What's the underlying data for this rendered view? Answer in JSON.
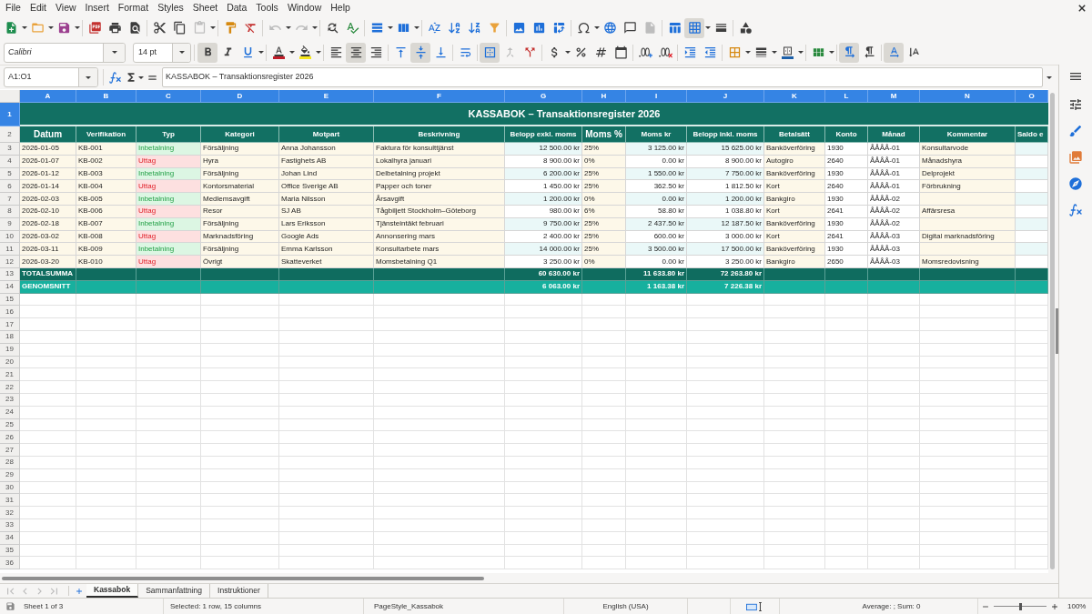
{
  "menu": [
    "File",
    "Edit",
    "View",
    "Insert",
    "Format",
    "Styles",
    "Sheet",
    "Data",
    "Tools",
    "Window",
    "Help"
  ],
  "standard_toolbar": {
    "groups": [
      [
        {
          "kind": "new",
          "dropdown": true,
          "pressed": false,
          "disabled": false
        },
        {
          "kind": "open",
          "dropdown": true,
          "pressed": false,
          "disabled": false
        },
        {
          "kind": "save",
          "dropdown": true,
          "pressed": false,
          "disabled": false
        }
      ],
      [
        {
          "kind": "pdf",
          "dropdown": false,
          "pressed": false,
          "disabled": false
        },
        {
          "kind": "print",
          "dropdown": false,
          "pressed": false,
          "disabled": false
        },
        {
          "kind": "preview",
          "dropdown": false,
          "pressed": false,
          "disabled": false
        }
      ],
      [
        {
          "kind": "cut",
          "dropdown": false,
          "pressed": false,
          "disabled": false
        },
        {
          "kind": "copy",
          "dropdown": false,
          "pressed": false,
          "disabled": false
        },
        {
          "kind": "paste",
          "dropdown": true,
          "pressed": false,
          "disabled": true
        }
      ],
      [
        {
          "kind": "clone",
          "dropdown": false,
          "pressed": false,
          "disabled": false
        },
        {
          "kind": "clear",
          "dropdown": false,
          "pressed": false,
          "disabled": false
        }
      ],
      [
        {
          "kind": "undo",
          "dropdown": true,
          "pressed": false,
          "disabled": true
        },
        {
          "kind": "redo",
          "dropdown": true,
          "pressed": false,
          "disabled": true
        }
      ],
      [
        {
          "kind": "find",
          "dropdown": false,
          "pressed": false,
          "disabled": false
        },
        {
          "kind": "spelling",
          "dropdown": false,
          "pressed": false,
          "disabled": false
        }
      ],
      [
        {
          "kind": "rows",
          "dropdown": true,
          "pressed": false,
          "disabled": false
        },
        {
          "kind": "columns",
          "dropdown": true,
          "pressed": false,
          "disabled": false
        }
      ],
      [
        {
          "kind": "sort",
          "dropdown": false,
          "pressed": false,
          "disabled": false
        },
        {
          "kind": "sortasc",
          "dropdown": false,
          "pressed": false,
          "disabled": false
        },
        {
          "kind": "sortdesc",
          "dropdown": false,
          "pressed": false,
          "disabled": false
        },
        {
          "kind": "filter",
          "dropdown": false,
          "pressed": false,
          "disabled": false
        }
      ],
      [
        {
          "kind": "image",
          "dropdown": false,
          "pressed": false,
          "disabled": false
        },
        {
          "kind": "chart",
          "dropdown": false,
          "pressed": false,
          "disabled": false
        },
        {
          "kind": "pivot",
          "dropdown": false,
          "pressed": false,
          "disabled": false
        }
      ],
      [
        {
          "kind": "symbol",
          "dropdown": true,
          "pressed": false,
          "disabled": false
        },
        {
          "kind": "hyperlink",
          "dropdown": false,
          "pressed": false,
          "disabled": false
        },
        {
          "kind": "comment",
          "dropdown": false,
          "pressed": false,
          "disabled": false
        },
        {
          "kind": "headers",
          "dropdown": false,
          "pressed": false,
          "disabled": true
        }
      ],
      [
        {
          "kind": "printarea",
          "dropdown": false,
          "pressed": false,
          "disabled": false
        },
        {
          "kind": "freeze",
          "dropdown": true,
          "pressed": true,
          "disabled": false
        },
        {
          "kind": "split",
          "dropdown": false,
          "pressed": false,
          "disabled": false
        }
      ],
      [
        {
          "kind": "shapes",
          "dropdown": false,
          "pressed": false,
          "disabled": false
        }
      ]
    ]
  },
  "formatting_toolbar": {
    "font_name": "Calibri",
    "font_size": "14 pt",
    "groups": [
      [
        {
          "kind": "bold",
          "dropdown": false,
          "pressed": true,
          "disabled": false
        },
        {
          "kind": "italic",
          "dropdown": false,
          "pressed": false,
          "disabled": false
        },
        {
          "kind": "underline",
          "dropdown": true,
          "pressed": false,
          "disabled": false
        }
      ],
      [
        {
          "kind": "fontcolor",
          "dropdown": true,
          "pressed": false,
          "disabled": false
        },
        {
          "kind": "highlight",
          "dropdown": true,
          "pressed": false,
          "disabled": false
        }
      ],
      [
        {
          "kind": "left",
          "dropdown": false,
          "pressed": false,
          "disabled": false
        },
        {
          "kind": "center",
          "dropdown": false,
          "pressed": true,
          "disabled": false
        },
        {
          "kind": "right",
          "dropdown": false,
          "pressed": false,
          "disabled": false
        }
      ],
      [
        {
          "kind": "top",
          "dropdown": false,
          "pressed": false,
          "disabled": false
        },
        {
          "kind": "middle",
          "dropdown": false,
          "pressed": true,
          "disabled": false
        },
        {
          "kind": "bottom",
          "dropdown": false,
          "pressed": false,
          "disabled": false
        }
      ],
      [
        {
          "kind": "wrap",
          "dropdown": false,
          "pressed": false,
          "disabled": false
        }
      ],
      [
        {
          "kind": "mergecenter",
          "dropdown": false,
          "pressed": true,
          "disabled": false
        },
        {
          "kind": "merge",
          "dropdown": false,
          "pressed": false,
          "disabled": true
        },
        {
          "kind": "unmerge",
          "dropdown": false,
          "pressed": false,
          "disabled": false
        }
      ],
      [
        {
          "kind": "currency",
          "dropdown": true,
          "pressed": false,
          "disabled": false
        },
        {
          "kind": "percent",
          "dropdown": false,
          "pressed": false,
          "disabled": false
        },
        {
          "kind": "number",
          "dropdown": false,
          "pressed": false,
          "disabled": false
        },
        {
          "kind": "date",
          "dropdown": false,
          "pressed": false,
          "disabled": false
        }
      ],
      [
        {
          "kind": "adddecimal",
          "dropdown": false,
          "pressed": false,
          "disabled": false
        },
        {
          "kind": "deldecimal",
          "dropdown": false,
          "pressed": false,
          "disabled": false
        }
      ],
      [
        {
          "kind": "indent",
          "dropdown": false,
          "pressed": false,
          "disabled": false
        },
        {
          "kind": "outdent",
          "dropdown": false,
          "pressed": false,
          "disabled": false
        }
      ],
      [
        {
          "kind": "borders",
          "dropdown": true,
          "pressed": false,
          "disabled": false
        },
        {
          "kind": "borderstyle",
          "dropdown": true,
          "pressed": false,
          "disabled": false
        },
        {
          "kind": "bordercolor",
          "dropdown": true,
          "pressed": false,
          "disabled": false
        }
      ],
      [
        {
          "kind": "conditional",
          "dropdown": true,
          "pressed": false,
          "disabled": false
        }
      ],
      [
        {
          "kind": "ltr",
          "dropdown": false,
          "pressed": true,
          "disabled": false
        },
        {
          "kind": "rtl",
          "dropdown": false,
          "pressed": false,
          "disabled": false
        }
      ],
      [
        {
          "kind": "orientation",
          "dropdown": false,
          "pressed": true,
          "disabled": false
        },
        {
          "kind": "stacked",
          "dropdown": false,
          "pressed": false,
          "disabled": false
        }
      ]
    ]
  },
  "formula_bar": {
    "name_box": "A1:O1",
    "content": "KASSABOK – Transaktionsregister 2026"
  },
  "sheet": {
    "column_headers": [
      {
        "label": "A",
        "selected": true
      },
      {
        "label": "B",
        "selected": true
      },
      {
        "label": "C",
        "selected": true
      },
      {
        "label": "D",
        "selected": true
      },
      {
        "label": "E",
        "selected": true
      },
      {
        "label": "F",
        "selected": true
      },
      {
        "label": "G",
        "selected": true
      },
      {
        "label": "H",
        "selected": true
      },
      {
        "label": "I",
        "selected": true
      },
      {
        "label": "J",
        "selected": true
      },
      {
        "label": "K",
        "selected": true
      },
      {
        "label": "L",
        "selected": true
      },
      {
        "label": "M",
        "selected": true
      },
      {
        "label": "N",
        "selected": true
      },
      {
        "label": "O",
        "selected": true
      }
    ],
    "row_headers": [
      {
        "label": "1",
        "selected": true
      },
      {
        "label": "2",
        "selected": false
      },
      {
        "label": "3",
        "selected": false
      },
      {
        "label": "4",
        "selected": false
      },
      {
        "label": "5",
        "selected": false
      },
      {
        "label": "6",
        "selected": false
      },
      {
        "label": "7",
        "selected": false
      },
      {
        "label": "8",
        "selected": false
      },
      {
        "label": "9",
        "selected": false
      },
      {
        "label": "10",
        "selected": false
      },
      {
        "label": "11",
        "selected": false
      },
      {
        "label": "12",
        "selected": false
      },
      {
        "label": "13",
        "selected": false
      },
      {
        "label": "14",
        "selected": false
      },
      {
        "label": "15",
        "selected": false
      },
      {
        "label": "16",
        "selected": false
      },
      {
        "label": "17",
        "selected": false
      },
      {
        "label": "18",
        "selected": false
      },
      {
        "label": "19",
        "selected": false
      },
      {
        "label": "20",
        "selected": false
      },
      {
        "label": "21",
        "selected": false
      },
      {
        "label": "22",
        "selected": false
      },
      {
        "label": "23",
        "selected": false
      },
      {
        "label": "24",
        "selected": false
      },
      {
        "label": "25",
        "selected": false
      },
      {
        "label": "26",
        "selected": false
      },
      {
        "label": "27",
        "selected": false
      },
      {
        "label": "28",
        "selected": false
      },
      {
        "label": "29",
        "selected": false
      },
      {
        "label": "30",
        "selected": false
      },
      {
        "label": "31",
        "selected": false
      },
      {
        "label": "32",
        "selected": false
      },
      {
        "label": "33",
        "selected": false
      },
      {
        "label": "34",
        "selected": false
      },
      {
        "label": "35",
        "selected": false
      },
      {
        "label": "36",
        "selected": false
      }
    ],
    "title": "KASSABOK – Transaktionsregister 2026",
    "header_row": [
      "Datum",
      "Verifikation",
      "Typ",
      "Kategori",
      "Motpart",
      "Beskrivning",
      "Belopp exkl. moms",
      "Moms %",
      "Moms kr",
      "Belopp inkl. moms",
      "Betalsätt",
      "Konto",
      "Månad",
      "Kommentar",
      "Saldo e"
    ],
    "rows": [
      {
        "kind": "income",
        "date": "2026-01-05",
        "voucher": "KB-001",
        "type": "Inbetalning",
        "category": "Försäljning",
        "counterparty": "Anna Johansson",
        "description": "Faktura för konsulttjänst",
        "amount_excl_vat": "12 500.00 kr",
        "vat_rate": "25%",
        "vat_amount": "3 125.00 kr",
        "amount_incl_vat": "15 625.00 kr",
        "payment_method": "Banköverföring",
        "account": "1930",
        "month": "ÅÅÅÅ-01",
        "comment": "Konsultarvode"
      },
      {
        "kind": "expense",
        "date": "2026-01-07",
        "voucher": "KB-002",
        "type": "Uttag",
        "category": "Hyra",
        "counterparty": "Fastighets AB",
        "description": "Lokalhyra januari",
        "amount_excl_vat": "8 900.00 kr",
        "vat_rate": "0%",
        "vat_amount": "0.00 kr",
        "amount_incl_vat": "8 900.00 kr",
        "payment_method": "Autogiro",
        "account": "2640",
        "month": "ÅÅÅÅ-01",
        "comment": "Månadshyra"
      },
      {
        "kind": "income",
        "date": "2026-01-12",
        "voucher": "KB-003",
        "type": "Inbetalning",
        "category": "Försäljning",
        "counterparty": "Johan Lind",
        "description": "Delbetalning projekt",
        "amount_excl_vat": "6 200.00 kr",
        "vat_rate": "25%",
        "vat_amount": "1 550.00 kr",
        "amount_incl_vat": "7 750.00 kr",
        "payment_method": "Banköverföring",
        "account": "1930",
        "month": "ÅÅÅÅ-01",
        "comment": "Delprojekt"
      },
      {
        "kind": "expense",
        "date": "2026-01-14",
        "voucher": "KB-004",
        "type": "Uttag",
        "category": "Kontorsmaterial",
        "counterparty": "Office Sverige AB",
        "description": "Papper och toner",
        "amount_excl_vat": "1 450.00 kr",
        "vat_rate": "25%",
        "vat_amount": "362.50 kr",
        "amount_incl_vat": "1 812.50 kr",
        "payment_method": "Kort",
        "account": "2640",
        "month": "ÅÅÅÅ-01",
        "comment": "Förbrukning"
      },
      {
        "kind": "income",
        "date": "2026-02-03",
        "voucher": "KB-005",
        "type": "Inbetalning",
        "category": "Medlemsavgift",
        "counterparty": "Maria Nilsson",
        "description": "Årsavgift",
        "amount_excl_vat": "1 200.00 kr",
        "vat_rate": "0%",
        "vat_amount": "0.00 kr",
        "amount_incl_vat": "1 200.00 kr",
        "payment_method": "Bankgiro",
        "account": "1930",
        "month": "ÅÅÅÅ-02"
      },
      {
        "kind": "expense",
        "date": "2026-02-10",
        "voucher": "KB-006",
        "type": "Uttag",
        "category": "Resor",
        "counterparty": "SJ AB",
        "description": "Tågbiljett Stockholm–Göteborg",
        "amount_excl_vat": "980.00 kr",
        "vat_rate": "6%",
        "vat_amount": "58.80 kr",
        "amount_incl_vat": "1 038.80 kr",
        "payment_method": "Kort",
        "account": "2641",
        "month": "ÅÅÅÅ-02",
        "comment": "Affärsresa"
      },
      {
        "kind": "income",
        "date": "2026-02-18",
        "voucher": "KB-007",
        "type": "Inbetalning",
        "category": "Försäljning",
        "counterparty": "Lars Eriksson",
        "description": "Tjänsteintäkt februari",
        "amount_excl_vat": "9 750.00 kr",
        "vat_rate": "25%",
        "vat_amount": "2 437.50 kr",
        "amount_incl_vat": "12 187.50 kr",
        "payment_method": "Banköverföring",
        "account": "1930",
        "month": "ÅÅÅÅ-02"
      },
      {
        "kind": "expense",
        "date": "2026-03-02",
        "voucher": "KB-008",
        "type": "Uttag",
        "category": "Marknadsföring",
        "counterparty": "Google Ads",
        "description": "Annonsering mars",
        "amount_excl_vat": "2 400.00 kr",
        "vat_rate": "25%",
        "vat_amount": "600.00 kr",
        "amount_incl_vat": "3 000.00 kr",
        "payment_method": "Kort",
        "account": "2641",
        "month": "ÅÅÅÅ-03",
        "comment": "Digital marknadsföring"
      },
      {
        "kind": "income",
        "date": "2026-03-11",
        "voucher": "KB-009",
        "type": "Inbetalning",
        "category": "Försäljning",
        "counterparty": "Emma Karlsson",
        "description": "Konsultarbete mars",
        "amount_excl_vat": "14 000.00 kr",
        "vat_rate": "25%",
        "vat_amount": "3 500.00 kr",
        "amount_incl_vat": "17 500.00 kr",
        "payment_method": "Banköverföring",
        "account": "1930",
        "month": "ÅÅÅÅ-03"
      },
      {
        "kind": "expense",
        "date": "2026-03-20",
        "voucher": "KB-010",
        "type": "Uttag",
        "category": "Övrigt",
        "counterparty": "Skatteverket",
        "description": "Momsbetalning Q1",
        "amount_excl_vat": "3 250.00 kr",
        "vat_rate": "0%",
        "vat_amount": "0.00 kr",
        "amount_incl_vat": "3 250.00 kr",
        "payment_method": "Bankgiro",
        "account": "2650",
        "month": "ÅÅÅÅ-03",
        "comment": "Momsredovisning"
      }
    ],
    "totals": [
      {
        "kind": "total",
        "label": "TOTALSUMMA",
        "amount_excl_vat": "60 630.00 kr",
        "vat_amount": "11 633.80 kr",
        "amount_incl_vat": "72 263.80 kr"
      },
      {
        "kind": "average",
        "label": "GENOMSNITT",
        "amount_excl_vat": "6 063.00 kr",
        "vat_amount": "1 163.38 kr",
        "amount_incl_vat": "7 226.38 kr"
      }
    ]
  },
  "sheet_tabs": [
    {
      "label": "Kassabok",
      "selected": true
    },
    {
      "label": "Sammanfattning",
      "selected": false
    },
    {
      "label": "Instruktioner",
      "selected": false
    }
  ],
  "status_bar": {
    "sheet_position": "Sheet 1 of 3",
    "selection": "Selected: 1 row, 15 columns",
    "page_style": "PageStyle_Kassabok",
    "language": "English (USA)",
    "summary": "Average: ; Sum: 0",
    "zoom": {
      "level": 0.5,
      "label": "100%"
    }
  }
}
